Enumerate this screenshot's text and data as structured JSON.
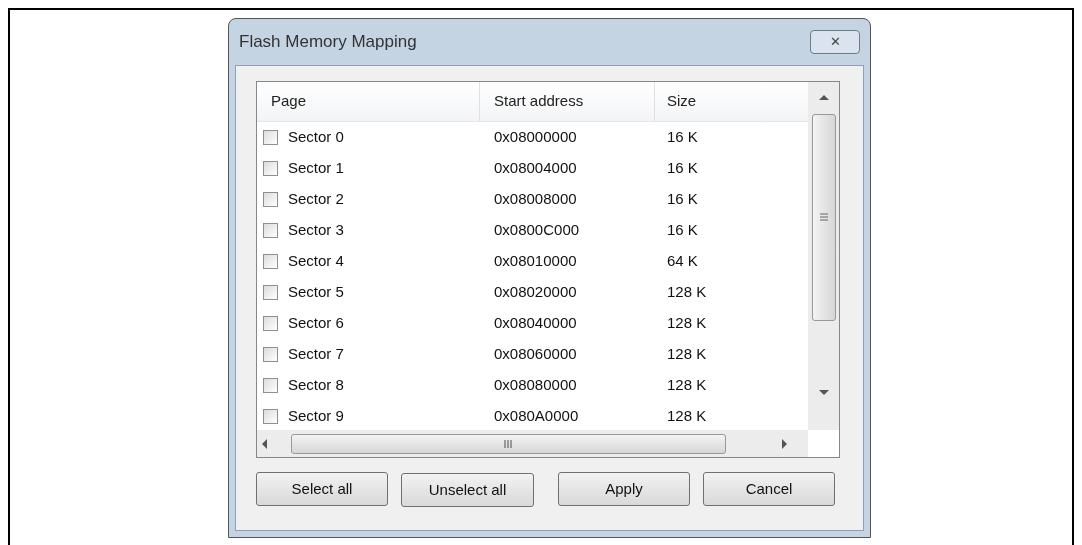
{
  "window": {
    "title": "Flash Memory Mapping",
    "close": "✕"
  },
  "table": {
    "columns": [
      "Page",
      "Start address",
      "Size"
    ],
    "rows": [
      {
        "page": "Sector 0",
        "start": "0x08000000",
        "size": "16 K",
        "checked": false
      },
      {
        "page": "Sector 1",
        "start": "0x08004000",
        "size": "16 K",
        "checked": false
      },
      {
        "page": "Sector 2",
        "start": "0x08008000",
        "size": "16 K",
        "checked": false
      },
      {
        "page": "Sector 3",
        "start": "0x0800C000",
        "size": "16 K",
        "checked": false
      },
      {
        "page": "Sector 4",
        "start": "0x08010000",
        "size": "64 K",
        "checked": false
      },
      {
        "page": "Sector 5",
        "start": "0x08020000",
        "size": "128 K",
        "checked": false
      },
      {
        "page": "Sector 6",
        "start": "0x08040000",
        "size": "128 K",
        "checked": false
      },
      {
        "page": "Sector 7",
        "start": "0x08060000",
        "size": "128 K",
        "checked": false
      },
      {
        "page": "Sector 8",
        "start": "0x08080000",
        "size": "128 K",
        "checked": false
      },
      {
        "page": "Sector 9",
        "start": "0x080A0000",
        "size": "128 K",
        "checked": false
      }
    ]
  },
  "buttons": [
    "Select all",
    "Unselect all",
    "Apply",
    "Cancel"
  ]
}
